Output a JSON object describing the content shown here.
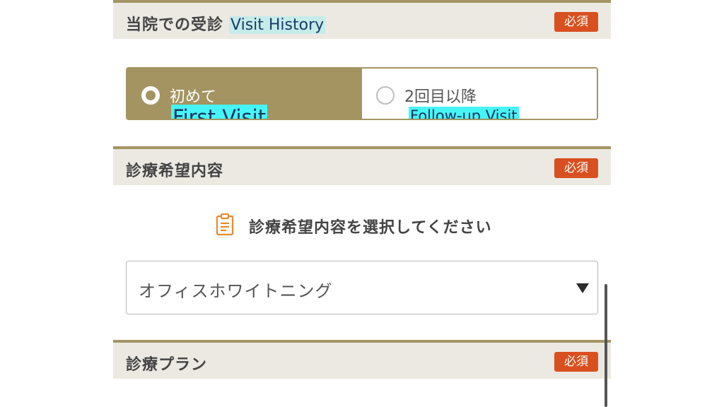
{
  "sections": {
    "visit_history": {
      "title_ja": "当院での受診",
      "title_en": "Visit History",
      "required_label": "必須",
      "options": [
        {
          "label": "初めて",
          "label_en": "First Visit",
          "selected": true
        },
        {
          "label": "2回目以降",
          "label_en": "Follow-up Visit",
          "selected": false
        }
      ]
    },
    "treatment_request": {
      "title": "診療希望内容",
      "required_label": "必須",
      "instruction": "診療希望内容を選択してください",
      "instruction_icon": "clipboard-icon",
      "select_value": "オフィスホワイトニング"
    },
    "treatment_plan": {
      "title": "診療プラン",
      "required_label": "必須"
    }
  },
  "colors": {
    "accent": "#a39461",
    "header_bg": "#ece9e2",
    "required_badge": "#d8501f",
    "highlight": "#46f5f7"
  }
}
